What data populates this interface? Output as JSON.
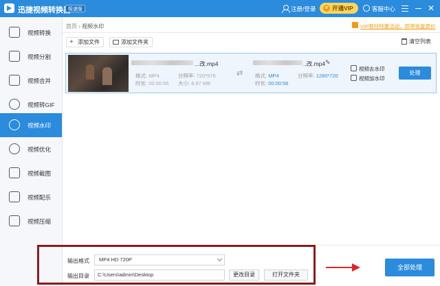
{
  "titlebar": {
    "app_title": "迅捷视频转换器",
    "edition": "极速版",
    "login": "注册/登录",
    "vip": "开通VIP",
    "vip_icon_text": "V",
    "service": "客服中心",
    "close_glyph": "✕"
  },
  "sidebar": {
    "items": [
      {
        "label": "视频转换",
        "icon": "video-convert-icon"
      },
      {
        "label": "视频分割",
        "icon": "split-icon"
      },
      {
        "label": "视频合并",
        "icon": "merge-icon"
      },
      {
        "label": "视频转GIF",
        "icon": "gif-icon"
      },
      {
        "label": "视频水印",
        "icon": "watermark-icon",
        "active": true
      },
      {
        "label": "视频优化",
        "icon": "optimize-icon"
      },
      {
        "label": "视频截图",
        "icon": "screenshot-icon"
      },
      {
        "label": "视频配乐",
        "icon": "music-icon"
      },
      {
        "label": "视频压缩",
        "icon": "compress-icon"
      }
    ]
  },
  "breadcrumb": {
    "home": "首页",
    "sep": "›",
    "current": "视频水印"
  },
  "promo": "VIP限时特惠活动，即将恢复原价",
  "toolbar": {
    "add_file": "添加文件",
    "add_file_glyph": "+",
    "add_folder": "添加文件夹",
    "clear_list": "清空列表"
  },
  "file": {
    "source_name_suffix": "...改.mp4",
    "output_name_suffix": "..改.mp4",
    "source": {
      "format_label": "格式:",
      "format": "MP4",
      "resolution_label": "分辨率:",
      "resolution": "720*576",
      "duration_label": "时长:",
      "duration": "00:00:56",
      "size_label": "大小:",
      "size": "8.87 MB"
    },
    "output": {
      "format_label": "格式:",
      "format": "MP4",
      "resolution_label": "分辨率:",
      "resolution": "1280*720",
      "duration_label": "时长:",
      "duration": "00:00:56"
    },
    "shuffle_glyph": "⇄",
    "pencil_glyph": "✎",
    "remove_watermark": "视频去水印",
    "add_watermark": "视频加水印",
    "process": "处理"
  },
  "bottom": {
    "format_label": "输出格式",
    "format_value": "MP4  HD 720P",
    "dir_label": "输出目录",
    "dir_value": "C:\\Users\\admin\\Desktop",
    "change_dir": "更改目录",
    "open_folder": "打开文件夹",
    "process_all": "全部处理"
  },
  "colors": {
    "accent": "#2b8bdc",
    "highlight": "#8b1a1a",
    "arrow": "#e0262b",
    "promo": "#f39c12"
  }
}
